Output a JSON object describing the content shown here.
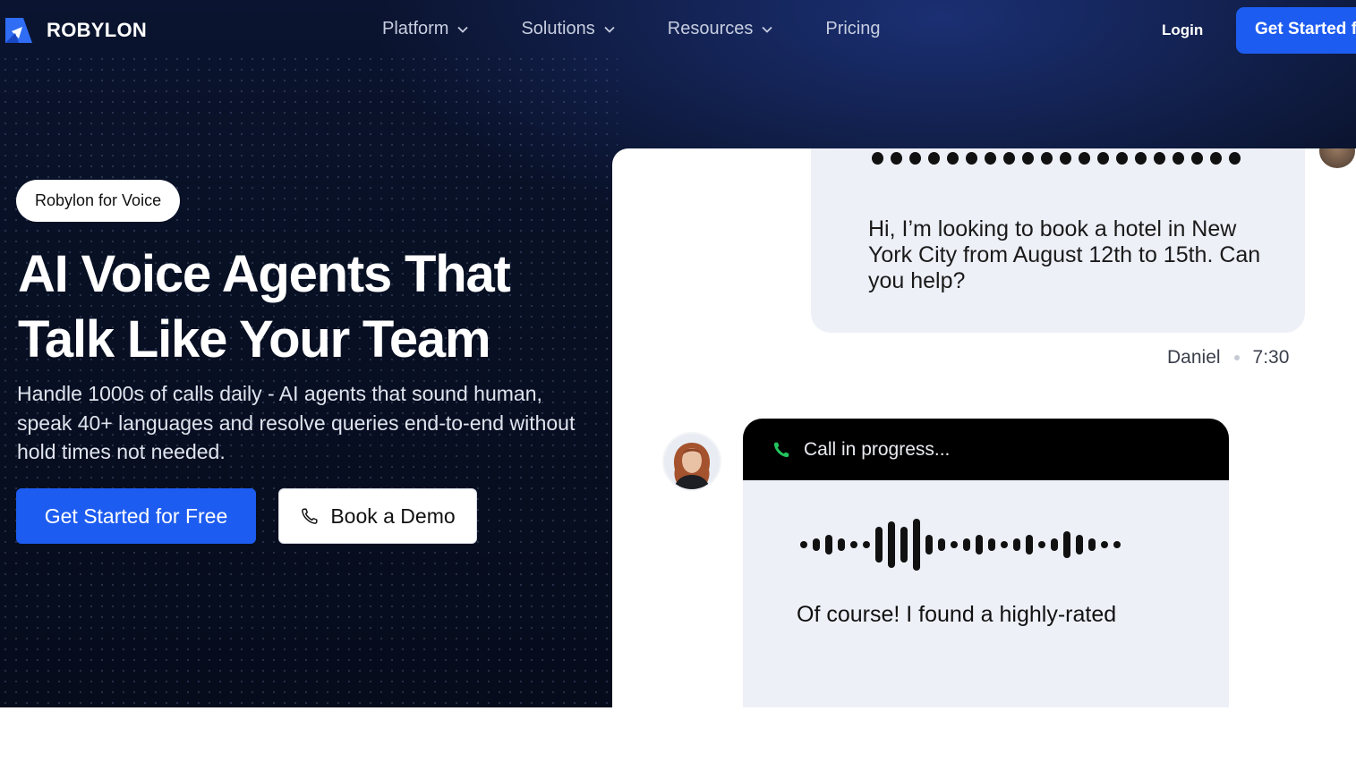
{
  "brand": {
    "name": "ROBYLON"
  },
  "nav": {
    "items": [
      {
        "label": "Platform",
        "has_dropdown": true
      },
      {
        "label": "Solutions",
        "has_dropdown": true
      },
      {
        "label": "Resources",
        "has_dropdown": true
      },
      {
        "label": "Pricing",
        "has_dropdown": false
      }
    ],
    "login": "Login",
    "cta": "Get Started f"
  },
  "hero": {
    "badge": "Robylon for Voice",
    "title_lines": [
      "AI Voice Agents That",
      "Talk Like Your Team"
    ],
    "subtitle": "Handle 1000s of calls daily - AI agents that sound human, speak 40+ languages and resolve queries end-to-end without hold times not needed.",
    "primary_button": "Get Started for Free",
    "secondary_button": "Book a Demo"
  },
  "chat": {
    "user_message": "Hi, I’m looking to book a hotel in New York City from August 12th to 15th. Can you help?",
    "sender": "Daniel",
    "time": "7:30",
    "call_status": "Call in progress...",
    "agent_message": "Of course! I found a highly-rated"
  },
  "colors": {
    "accent": "#1d5cf0",
    "call_icon": "#22c55e",
    "bubble": "#eef0f8"
  },
  "icons": {
    "logo": "robylon-logo-icon",
    "dropdown": "chevron-down-icon",
    "phone": "phone-icon",
    "call": "phone-call-icon"
  }
}
